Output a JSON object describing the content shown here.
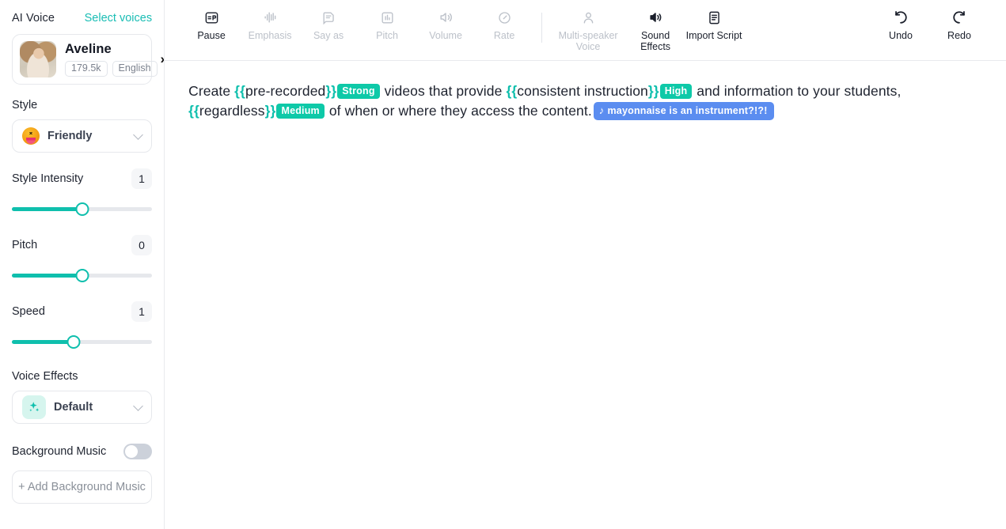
{
  "sidebar": {
    "ai_voice_label": "AI Voice",
    "select_voices_label": "Select voices",
    "voice": {
      "name": "Aveline",
      "usage_badge": "179.5k",
      "language_badge": "English"
    },
    "style": {
      "label": "Style",
      "selected": "Friendly",
      "emoji": "squinting-face-with-tongue"
    },
    "style_intensity": {
      "label": "Style Intensity",
      "value": "1",
      "percent": 50
    },
    "pitch": {
      "label": "Pitch",
      "value": "0",
      "percent": 50
    },
    "speed": {
      "label": "Speed",
      "value": "1",
      "percent": 44
    },
    "voice_effects": {
      "label": "Voice Effects",
      "selected": "Default",
      "icon": "sparkles-icon"
    },
    "background_music": {
      "label": "Background Music",
      "toggle_on": false,
      "add_label": "+ Add Background Music"
    }
  },
  "toolbar": {
    "items": [
      {
        "label": "Pause",
        "icon": "pause-tag-icon",
        "enabled": true
      },
      {
        "label": "Emphasis",
        "icon": "emphasis-waveform-icon",
        "enabled": false
      },
      {
        "label": "Say as",
        "icon": "say-as-document-icon",
        "enabled": false
      },
      {
        "label": "Pitch",
        "icon": "pitch-bars-icon",
        "enabled": false
      },
      {
        "label": "Volume",
        "icon": "volume-speaker-icon",
        "enabled": false
      },
      {
        "label": "Rate",
        "icon": "rate-gauge-icon",
        "enabled": false
      },
      {
        "label": "Multi-speaker Voice",
        "icon": "person-icon",
        "enabled": false
      },
      {
        "label": "Sound Effects",
        "icon": "sound-effects-speaker-icon",
        "enabled": true
      },
      {
        "label": "Import Script",
        "icon": "import-script-document-icon",
        "enabled": true
      }
    ],
    "undo_label": "Undo",
    "redo_label": "Redo"
  },
  "editor": {
    "segments": [
      {
        "type": "text",
        "value": "Create "
      },
      {
        "type": "brace",
        "value": "{{"
      },
      {
        "type": "text",
        "value": "pre-recorded"
      },
      {
        "type": "brace",
        "value": "}}"
      },
      {
        "type": "tag",
        "value": "Strong"
      },
      {
        "type": "text",
        "value": " videos that provide "
      },
      {
        "type": "brace",
        "value": "{{"
      },
      {
        "type": "text",
        "value": "consistent instruction"
      },
      {
        "type": "brace",
        "value": "}}"
      },
      {
        "type": "tag",
        "value": "High"
      },
      {
        "type": "text",
        "value": " and information to your students, "
      },
      {
        "type": "brace",
        "value": "{{"
      },
      {
        "type": "text",
        "value": "regardless"
      },
      {
        "type": "brace",
        "value": "}}"
      },
      {
        "type": "tag",
        "value": "Medium"
      },
      {
        "type": "text",
        "value": " of when or where they access the content."
      },
      {
        "type": "sfx",
        "value": "mayonnaise is an instrument?!?!"
      }
    ]
  },
  "colors": {
    "teal": "#0fbfad",
    "tag_teal": "#0ec9a8",
    "sfx_blue": "#5b8df0",
    "link_teal": "#19bdb4"
  }
}
